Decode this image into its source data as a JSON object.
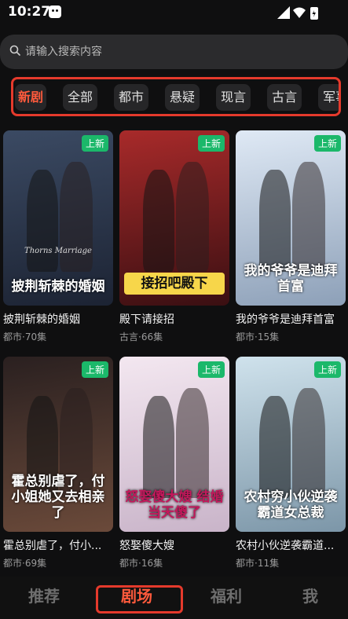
{
  "status": {
    "time": "10:27"
  },
  "search": {
    "placeholder": "请输入搜索内容"
  },
  "tabs": [
    {
      "label": "新剧",
      "active": true
    },
    {
      "label": "全部"
    },
    {
      "label": "都市"
    },
    {
      "label": "悬疑"
    },
    {
      "label": "现言"
    },
    {
      "label": "古言"
    },
    {
      "label": "军事"
    }
  ],
  "dramas": [
    {
      "title": "披荆斩棘的婚姻",
      "meta": "都市·70集",
      "badge": "上新",
      "poster_text": "披荆斩棘的婚姻",
      "poster_sub": "Thorns Marriage",
      "colors": [
        "#3b4a63",
        "#1c2333"
      ]
    },
    {
      "title": "殿下请接招",
      "meta": "古言·66集",
      "badge": "上新",
      "poster_text": "接招吧殿下",
      "colors": [
        "#a82a2a",
        "#3a0f12"
      ]
    },
    {
      "title": "我的爷爷是迪拜首富",
      "meta": "都市·15集",
      "badge": "上新",
      "poster_text": "我的爷爷是迪拜首富",
      "colors": [
        "#dfe9f5",
        "#8da0b8"
      ]
    },
    {
      "title": "霍总别虐了，付小...",
      "meta": "都市·69集",
      "badge": "上新",
      "poster_text": "霍总别虐了，付小姐她又去相亲了",
      "colors": [
        "#2a2020",
        "#6b4a3a"
      ]
    },
    {
      "title": "怒娶傻大嫂",
      "meta": "都市·16集",
      "badge": "上新",
      "poster_text": "怒娶傻大嫂 结婚当天傻了",
      "colors": [
        "#f3e7f0",
        "#c9b4c9"
      ]
    },
    {
      "title": "农村小伙逆袭霸道...",
      "meta": "都市·11集",
      "badge": "上新",
      "poster_text": "农村穷小伙逆袭霸道女总裁",
      "colors": [
        "#cfe2ec",
        "#7c96a8"
      ]
    }
  ],
  "bottom_nav": [
    {
      "label": "推荐"
    },
    {
      "label": "剧场",
      "active": true
    },
    {
      "label": "福利"
    },
    {
      "label": "我"
    }
  ],
  "accent": "#ff5a3c",
  "badge_color": "#1bb86a"
}
